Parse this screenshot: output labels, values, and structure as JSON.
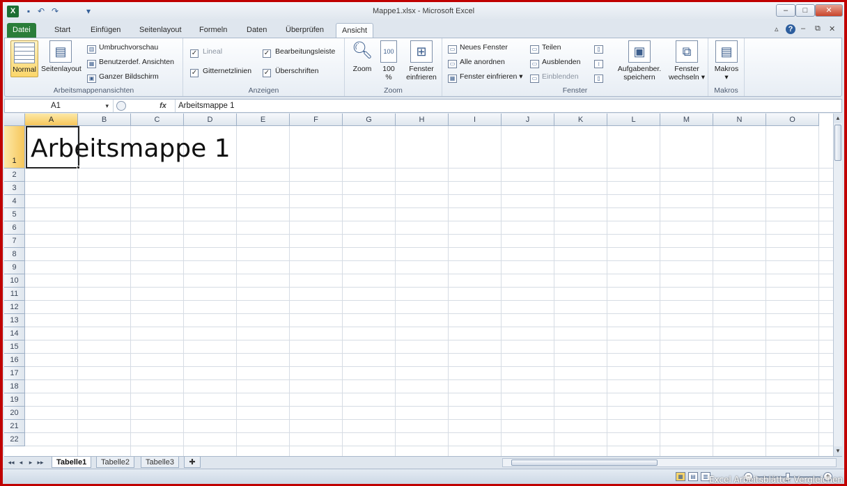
{
  "window": {
    "title": "Mappe1.xlsx - Microsoft Excel",
    "controls": {
      "minimize": "–",
      "maximize": "□",
      "close": "✕"
    }
  },
  "qat": {
    "app_icon": "X",
    "save_icon": "▪",
    "undo_icon": "↶",
    "redo_icon": "↷",
    "customize_icon": "▾"
  },
  "ribbon_tabs": [
    {
      "label": "Datei"
    },
    {
      "label": "Start"
    },
    {
      "label": "Einfügen"
    },
    {
      "label": "Seitenlayout"
    },
    {
      "label": "Formeln"
    },
    {
      "label": "Daten"
    },
    {
      "label": "Überprüfen"
    },
    {
      "label": "Ansicht"
    }
  ],
  "ribbon_tools": {
    "collapse": "▵",
    "help": "?",
    "min": "–",
    "restore": "⧉",
    "close": "✕"
  },
  "groups": {
    "workbook_views": {
      "label": "Arbeitsmappenansichten",
      "normal": "Normal",
      "page_layout": "Seitenlayout",
      "page_break": "Umbruchvorschau",
      "custom_views": "Benutzerdef. Ansichten",
      "full_screen": "Ganzer Bildschirm"
    },
    "show": {
      "label": "Anzeigen",
      "ruler": "Lineal",
      "gridlines": "Gitternetzlinien",
      "formula_bar": "Bearbeitungsleiste",
      "headings": "Überschriften"
    },
    "zoom": {
      "label": "Zoom",
      "zoom": "Zoom",
      "hundred_line1": "100",
      "hundred_line2": "%",
      "fit_line1": "Fenster",
      "fit_line2": "einfrieren"
    },
    "window": {
      "label": "Fenster",
      "new_window": "Neues Fenster",
      "arrange_all": "Alle anordnen",
      "freeze_panes": "Fenster einfrieren",
      "split": "Teilen",
      "hide": "Ausblenden",
      "unhide": "Einblenden",
      "save_ws_line1": "Aufgabenber.",
      "save_ws_line2": "speichern",
      "switch_line1": "Fenster",
      "switch_line2": "wechseln"
    },
    "macros": {
      "label": "Makros",
      "macros": "Makros"
    }
  },
  "formula_bar": {
    "name_box": "A1",
    "fx": "fx",
    "content": "Arbeitsmappe 1"
  },
  "columns": [
    "A",
    "B",
    "C",
    "D",
    "E",
    "F",
    "G",
    "H",
    "I",
    "J",
    "K",
    "L",
    "M",
    "N",
    "O"
  ],
  "rows": [
    "1",
    "2",
    "3",
    "4",
    "5",
    "6",
    "7",
    "8",
    "9",
    "10",
    "11",
    "12",
    "13",
    "14",
    "15",
    "16",
    "17",
    "18",
    "19",
    "20",
    "21",
    "22"
  ],
  "cell_a1": "Arbeitsmappe 1",
  "sheet_tabs": [
    {
      "label": "Tabelle1"
    },
    {
      "label": "Tabelle2"
    },
    {
      "label": "Tabelle3"
    }
  ],
  "sheet_nav": {
    "first": "◂◂",
    "prev": "◂",
    "next": "▸",
    "last": "▸▸"
  },
  "statusbar": {
    "zoom_minus": "−",
    "zoom_plus": "+"
  },
  "watermark": "Excel Arbeitsblätter Vergleichen",
  "colors": {
    "file_tab": "#2a7d3a",
    "selection": "#f6c65b",
    "frame": "#c00000"
  }
}
